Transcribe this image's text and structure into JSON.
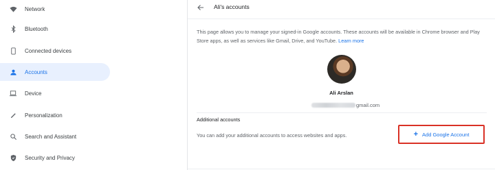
{
  "sidebar": {
    "items": [
      {
        "label": "Network",
        "icon": "wifi-icon",
        "active": false
      },
      {
        "label": "Bluetooth",
        "icon": "bluetooth-icon",
        "active": false
      },
      {
        "label": "Connected devices",
        "icon": "phone-icon",
        "active": false
      },
      {
        "label": "Accounts",
        "icon": "person-icon",
        "active": true
      },
      {
        "label": "Device",
        "icon": "laptop-icon",
        "active": false
      },
      {
        "label": "Personalization",
        "icon": "pen-icon",
        "active": false
      },
      {
        "label": "Search and Assistant",
        "icon": "search-icon",
        "active": false
      },
      {
        "label": "Security and Privacy",
        "icon": "shield-icon",
        "active": false
      }
    ]
  },
  "header": {
    "title": "Ali's accounts",
    "back_icon": "arrow-back-icon"
  },
  "main": {
    "description": "This page allows you to manage your signed-in Google accounts. These accounts will be available in Chrome browser and Play Store apps, as well as services like Gmail, Drive, and YouTube.",
    "learn_more": "Learn more",
    "user": {
      "name": "Ali Arslan",
      "email_suffix": "gmail.com"
    },
    "additional": {
      "title": "Additional accounts",
      "description": "You can add your additional accounts to access websites and apps.",
      "button_label": "Add Google Account",
      "button_icon": "plus-icon"
    }
  },
  "colors": {
    "accent": "#1a73e8",
    "active_bg": "#e8f0fe",
    "highlight_border": "#d93025"
  }
}
